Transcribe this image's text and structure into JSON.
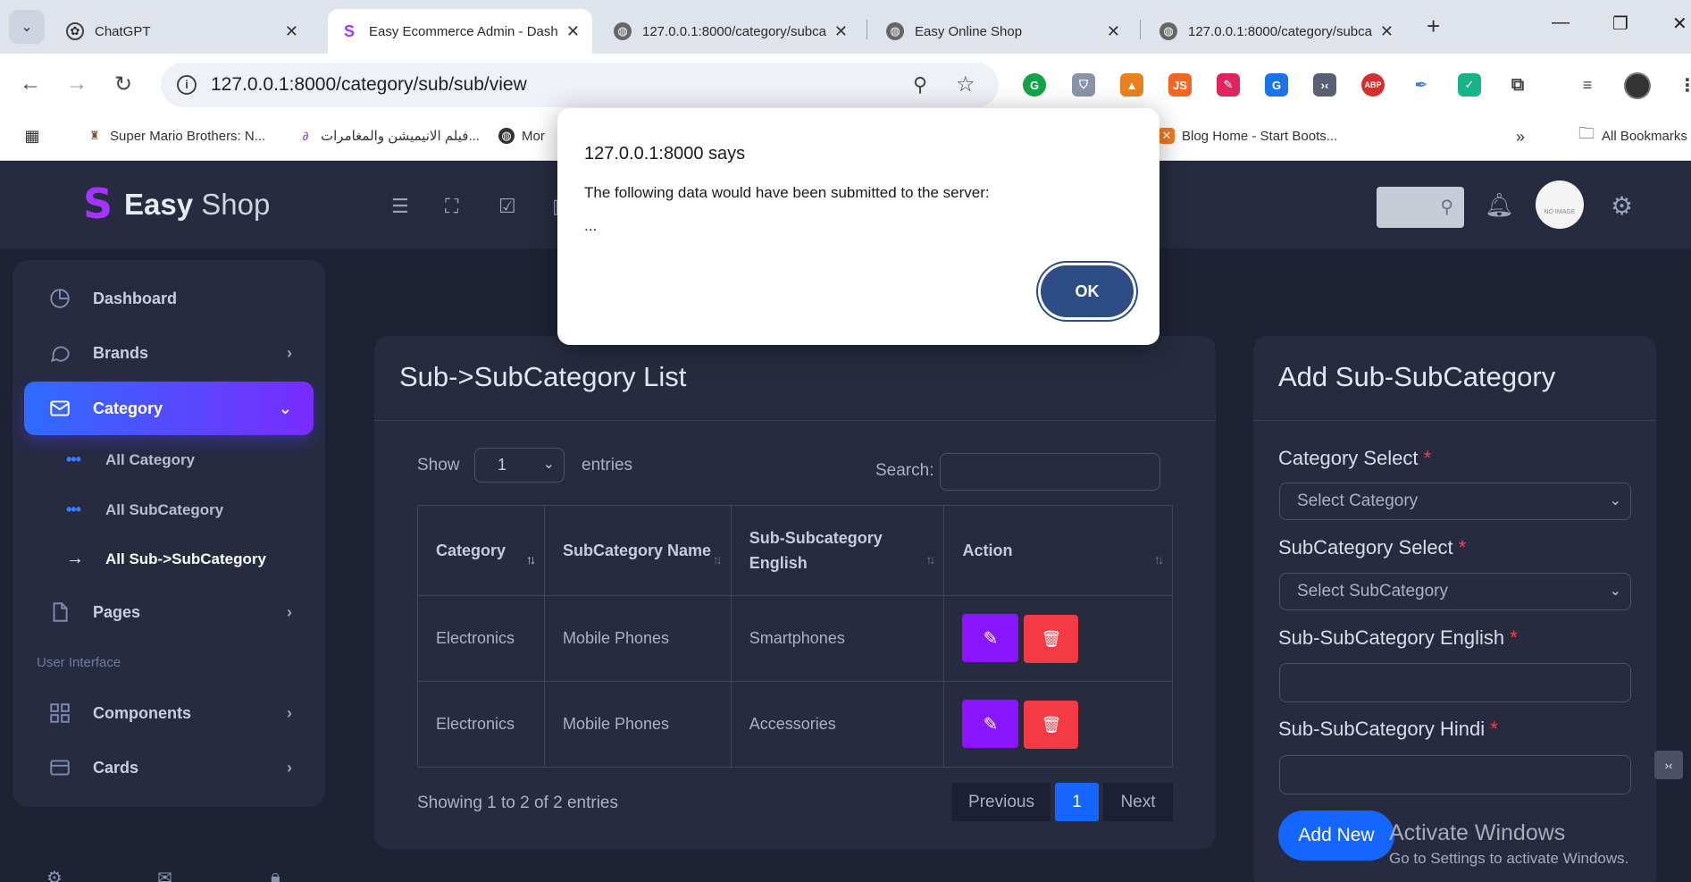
{
  "browser": {
    "tabs": [
      {
        "title": "ChatGPT",
        "icon": "chatgpt-icon"
      },
      {
        "title": "Easy Ecommerce Admin - Dash",
        "icon": "easyshop-icon"
      },
      {
        "title": "127.0.0.1:8000/category/subca",
        "icon": "globe-icon"
      },
      {
        "title": "Easy Online Shop",
        "icon": "globe-icon"
      },
      {
        "title": "127.0.0.1:8000/category/subca",
        "icon": "globe-icon"
      }
    ],
    "url": "127.0.0.1:8000/category/sub/sub/view",
    "bookmarks": [
      {
        "label": "Super Mario Brothers: N..."
      },
      {
        "label": "فيلم الانيميشن والمغامرات..."
      },
      {
        "label": "Mor"
      },
      {
        "label": "Blog Home - Start Boots..."
      }
    ],
    "all_bookmarks": "All Bookmarks"
  },
  "dialog": {
    "title": "127.0.0.1:8000 says",
    "message": "The following data would have been submitted to the server:",
    "body": "...",
    "ok_label": "OK"
  },
  "brand": {
    "strong": "Easy",
    "light": "Shop"
  },
  "sidebar": {
    "items": [
      {
        "label": "Dashboard"
      },
      {
        "label": "Brands"
      },
      {
        "label": "Category"
      },
      {
        "label": "Pages"
      },
      {
        "label": "Components"
      },
      {
        "label": "Cards"
      }
    ],
    "subitems": [
      {
        "label": "All Category"
      },
      {
        "label": "All SubCategory"
      },
      {
        "label": "All Sub->SubCategory"
      }
    ],
    "section_label": "User Interface"
  },
  "topbar": {
    "avatar_text": "NO IMAGE"
  },
  "list": {
    "title": "Sub->SubCategory List",
    "show_label": "Show",
    "entries_value": "1",
    "entries_label": "entries",
    "search_label": "Search:",
    "columns": [
      "Category",
      "SubCategory Name",
      "Sub-Subcategory English",
      "Action"
    ],
    "rows": [
      {
        "category": "Electronics",
        "subcategory": "Mobile Phones",
        "subsub": "Smartphones"
      },
      {
        "category": "Electronics",
        "subcategory": "Mobile Phones",
        "subsub": "Accessories"
      }
    ],
    "info": "Showing 1 to 2 of 2 entries",
    "pagination": {
      "previous": "Previous",
      "current": "1",
      "next": "Next"
    }
  },
  "form": {
    "title": "Add Sub-SubCategory",
    "category_label": "Category Select",
    "category_placeholder": "Select Category",
    "subcategory_label": "SubCategory Select",
    "subcategory_placeholder": "Select SubCategory",
    "english_label": "Sub-SubCategory English",
    "hindi_label": "Sub-SubCategory Hindi",
    "required_mark": "*",
    "submit_label": "Add New"
  },
  "watermark": {
    "line1": "Activate Windows",
    "line2": "Go to Settings to activate Windows."
  },
  "colors": {
    "accent_blue": "#1565ff",
    "accent_purple": "#8a14ff",
    "danger": "#f43a45",
    "panel": "#262b3f",
    "background": "#1e2235"
  }
}
